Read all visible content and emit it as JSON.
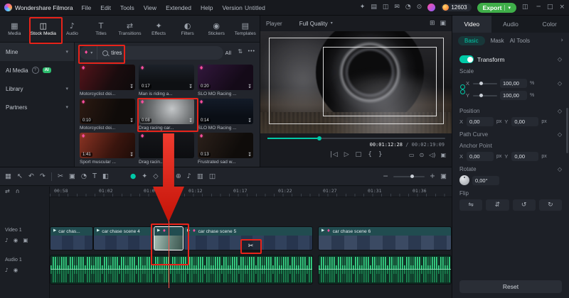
{
  "colors": {
    "accent_teal": "#00c9a7",
    "export_green": "#3fae49",
    "annotation_red": "#e8231a",
    "waveform_green": "#3ddc8e",
    "gem_pink": "#ff4fa0",
    "ai_badge_green": "#2dbd6e"
  },
  "menubar": {
    "app_name": "Wondershare Filmora",
    "menus": [
      "File",
      "Edit",
      "Tools",
      "View",
      "Extended",
      "Help",
      "Version"
    ],
    "project_title": "Untitled",
    "coins": "12603",
    "export_label": "Export"
  },
  "media_tabs": {
    "items": [
      {
        "label": "Media"
      },
      {
        "label": "Stock Media"
      },
      {
        "label": "Audio"
      },
      {
        "label": "Titles"
      },
      {
        "label": "Transitions"
      },
      {
        "label": "Effects"
      },
      {
        "label": "Filters"
      },
      {
        "label": "Stickers"
      },
      {
        "label": "Templates"
      }
    ]
  },
  "sidebar": {
    "items": [
      {
        "label": "Mine"
      },
      {
        "label": "AI Media",
        "badge": "AI"
      },
      {
        "label": "Library"
      },
      {
        "label": "Partners"
      }
    ]
  },
  "search": {
    "value": "tires",
    "all_label": "All",
    "more": "•••"
  },
  "stock_grid": {
    "items": [
      {
        "title": "Motorcyclist doi...",
        "duration": ""
      },
      {
        "title": "Man is riding a...",
        "duration": "0:17"
      },
      {
        "title": "SLO MO Racing ...",
        "duration": "0:20"
      },
      {
        "title": "Motorcyclist doi...",
        "duration": "0:10"
      },
      {
        "title": "Drag racing car...",
        "duration": "0:08"
      },
      {
        "title": "SLO MO Racing ...",
        "duration": "0:14"
      },
      {
        "title": "Sport muscular ...",
        "duration": "1:41"
      },
      {
        "title": "Drag racin...",
        "duration": ""
      },
      {
        "title": "Frustrated sad w...",
        "duration": "0:13"
      }
    ]
  },
  "player": {
    "label": "Player",
    "quality": "Full Quality",
    "current": "00:01:12:28",
    "separator": "/",
    "total": "00:02:19:09"
  },
  "properties": {
    "tabs": [
      {
        "label": "Video"
      },
      {
        "label": "Audio"
      },
      {
        "label": "Color"
      }
    ],
    "subtabs": [
      {
        "label": "Basic"
      },
      {
        "label": "Mask"
      },
      {
        "label": "AI Tools"
      }
    ],
    "transform_label": "Transform",
    "scale_label": "Scale",
    "x_label": "X",
    "y_label": "Y",
    "scale_x": "100,00",
    "scale_y": "100,00",
    "percent": "%",
    "position_label": "Position",
    "pos_x": "0,00",
    "pos_y": "0,00",
    "px": "px",
    "path_curve_label": "Path Curve",
    "anchor_label": "Anchor Point",
    "anchor_x": "0,00",
    "anchor_y": "0,00",
    "rotate_label": "Rotate",
    "rotate_value": "0,00°",
    "flip_label": "Flip",
    "reset_label": "Reset"
  },
  "timeline": {
    "ruler": [
      "00:58",
      "01:02",
      "01:07",
      "01:12",
      "01:17",
      "01:22",
      "01:27",
      "01:31",
      "01:36"
    ],
    "tracks": [
      {
        "name": "Video 1"
      },
      {
        "name": "Audio 1"
      }
    ],
    "clips": [
      {
        "label": "car chas..."
      },
      {
        "label": "car chase scene 4"
      },
      {
        "label": "car chase scene 5"
      },
      {
        "label": "car chase scene 6"
      }
    ]
  }
}
